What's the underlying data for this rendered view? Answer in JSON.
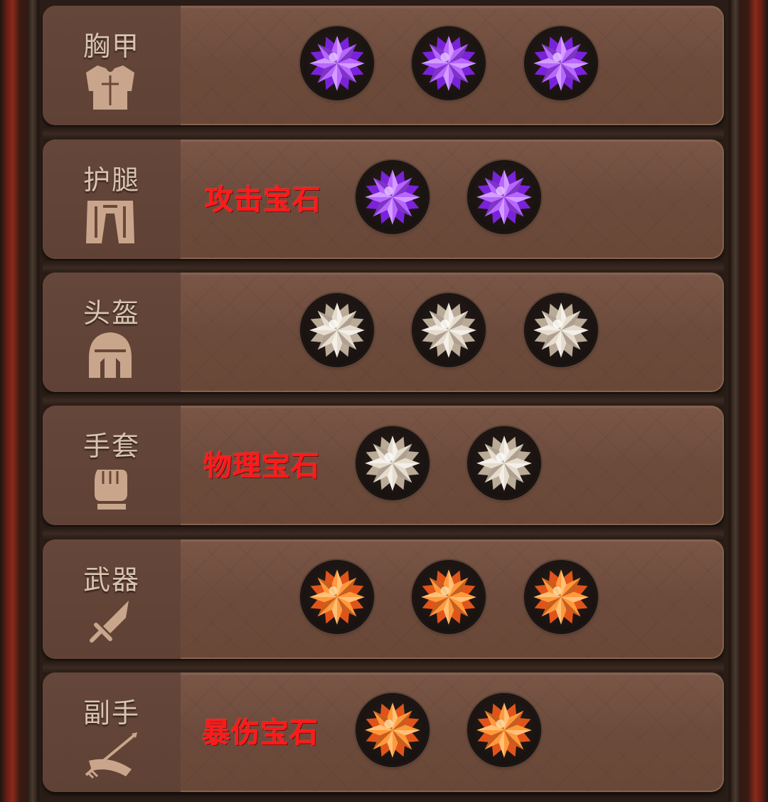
{
  "rows": [
    {
      "key": "chest",
      "label": "胸甲",
      "icon": "chest-armor-icon",
      "gem_color": "purple",
      "gem_count": 3,
      "note": ""
    },
    {
      "key": "legs",
      "label": "护腿",
      "icon": "leg-armor-icon",
      "gem_color": "purple",
      "gem_count": 2,
      "note": "攻击宝石"
    },
    {
      "key": "helmet",
      "label": "头盔",
      "icon": "helmet-icon",
      "gem_color": "white",
      "gem_count": 3,
      "note": ""
    },
    {
      "key": "gloves",
      "label": "手套",
      "icon": "glove-fist-icon",
      "gem_color": "white",
      "gem_count": 2,
      "note": "物理宝石"
    },
    {
      "key": "weapon",
      "label": "武器",
      "icon": "sword-icon",
      "gem_color": "orange",
      "gem_count": 3,
      "note": ""
    },
    {
      "key": "offhand",
      "label": "副手",
      "icon": "offhand-bow-icon",
      "gem_color": "orange",
      "gem_count": 2,
      "note": "暴伤宝石"
    }
  ],
  "colors": {
    "purple": [
      "#e9c8ff",
      "#b866ff",
      "#7a22d9",
      "#4a0f8f"
    ],
    "white": [
      "#ffffff",
      "#e6dccd",
      "#b9ab97",
      "#7d705f"
    ],
    "orange": [
      "#ffe0a8",
      "#ff9a3c",
      "#e0541a",
      "#9a2c08"
    ],
    "annotation": "#ff1a1a"
  }
}
